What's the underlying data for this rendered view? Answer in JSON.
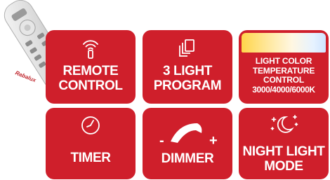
{
  "colors": {
    "tile_red": "#cf1f2b",
    "text": "#ffffff"
  },
  "remote": {
    "brand_text": "Rabalux"
  },
  "tiles": [
    {
      "icon": "wifi-signal-icon",
      "lines": [
        "REMOTE",
        "CONTROL"
      ]
    },
    {
      "icon": "copy-pages-icon",
      "lines": [
        "3 LIGHT",
        "PROGRAM"
      ]
    },
    {
      "icon": "color-gradient-bar",
      "lines": [
        "LIGHT COLOR",
        "TEMPERATURE",
        "CONTROL",
        "3000/4000/6000K"
      ]
    },
    {
      "icon": "clock-icon",
      "lines": [
        "TIMER"
      ]
    },
    {
      "icon": "dimmer-arc-icon",
      "lines": [
        "DIMMER"
      ],
      "minus": "-",
      "plus": "+"
    },
    {
      "icon": "moon-stars-icon",
      "lines": [
        "NIGHT LIGHT",
        "MODE"
      ]
    }
  ]
}
